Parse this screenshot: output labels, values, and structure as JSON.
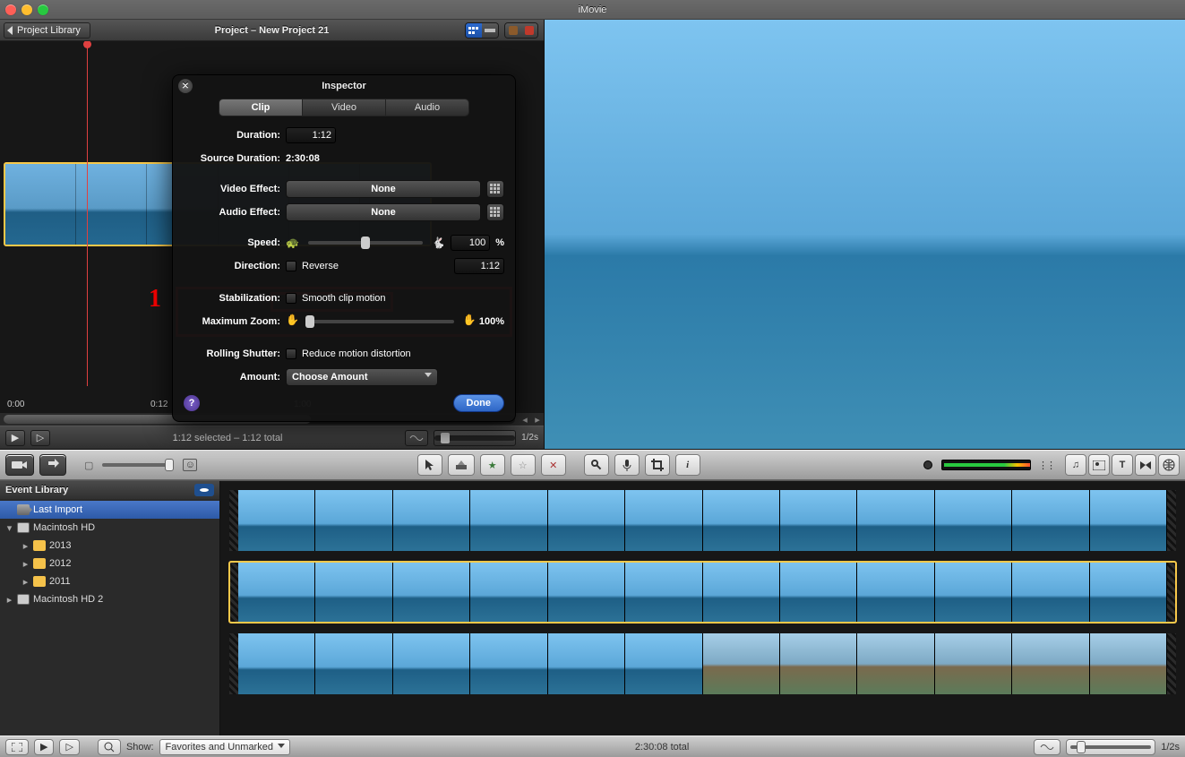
{
  "app": {
    "title": "iMovie"
  },
  "project": {
    "back_label": "Project Library",
    "title": "Project – New Project 21",
    "time_labels": [
      "0:00",
      "0:12",
      "1:00"
    ],
    "toolbar": {
      "selection_text": "1:12 selected – 1:12 total",
      "scale_label": "1/2s"
    }
  },
  "inspector": {
    "title": "Inspector",
    "tabs": {
      "clip": "Clip",
      "video": "Video",
      "audio": "Audio"
    },
    "duration": {
      "label": "Duration:",
      "value": "1:12"
    },
    "source": {
      "label": "Source Duration:",
      "value": "2:30:08"
    },
    "video_effect": {
      "label": "Video Effect:",
      "value": "None"
    },
    "audio_effect": {
      "label": "Audio Effect:",
      "value": "None"
    },
    "speed": {
      "label": "Speed:",
      "percent": "100",
      "pct_suffix": "%",
      "time": "1:12"
    },
    "direction": {
      "label": "Direction:",
      "checkbox": "Reverse"
    },
    "stabilization": {
      "label": "Stabilization:",
      "checkbox": "Smooth clip motion"
    },
    "max_zoom": {
      "label": "Maximum Zoom:",
      "value": "100%"
    },
    "rolling": {
      "label": "Rolling Shutter:",
      "checkbox": "Reduce motion distortion"
    },
    "amount": {
      "label": "Amount:",
      "value": "Choose Amount"
    },
    "help": "?",
    "done": "Done",
    "annotation": "1"
  },
  "event": {
    "header": "Event Library",
    "last_import": "Last Import",
    "mac_hd": "Macintosh HD",
    "y2013": "2013",
    "y2012": "2012",
    "y2011": "2011",
    "mac_hd2": "Macintosh HD 2"
  },
  "bottom": {
    "show_label": "Show:",
    "filter": "Favorites and Unmarked",
    "total": "2:30:08 total",
    "scale_label": "1/2s"
  }
}
